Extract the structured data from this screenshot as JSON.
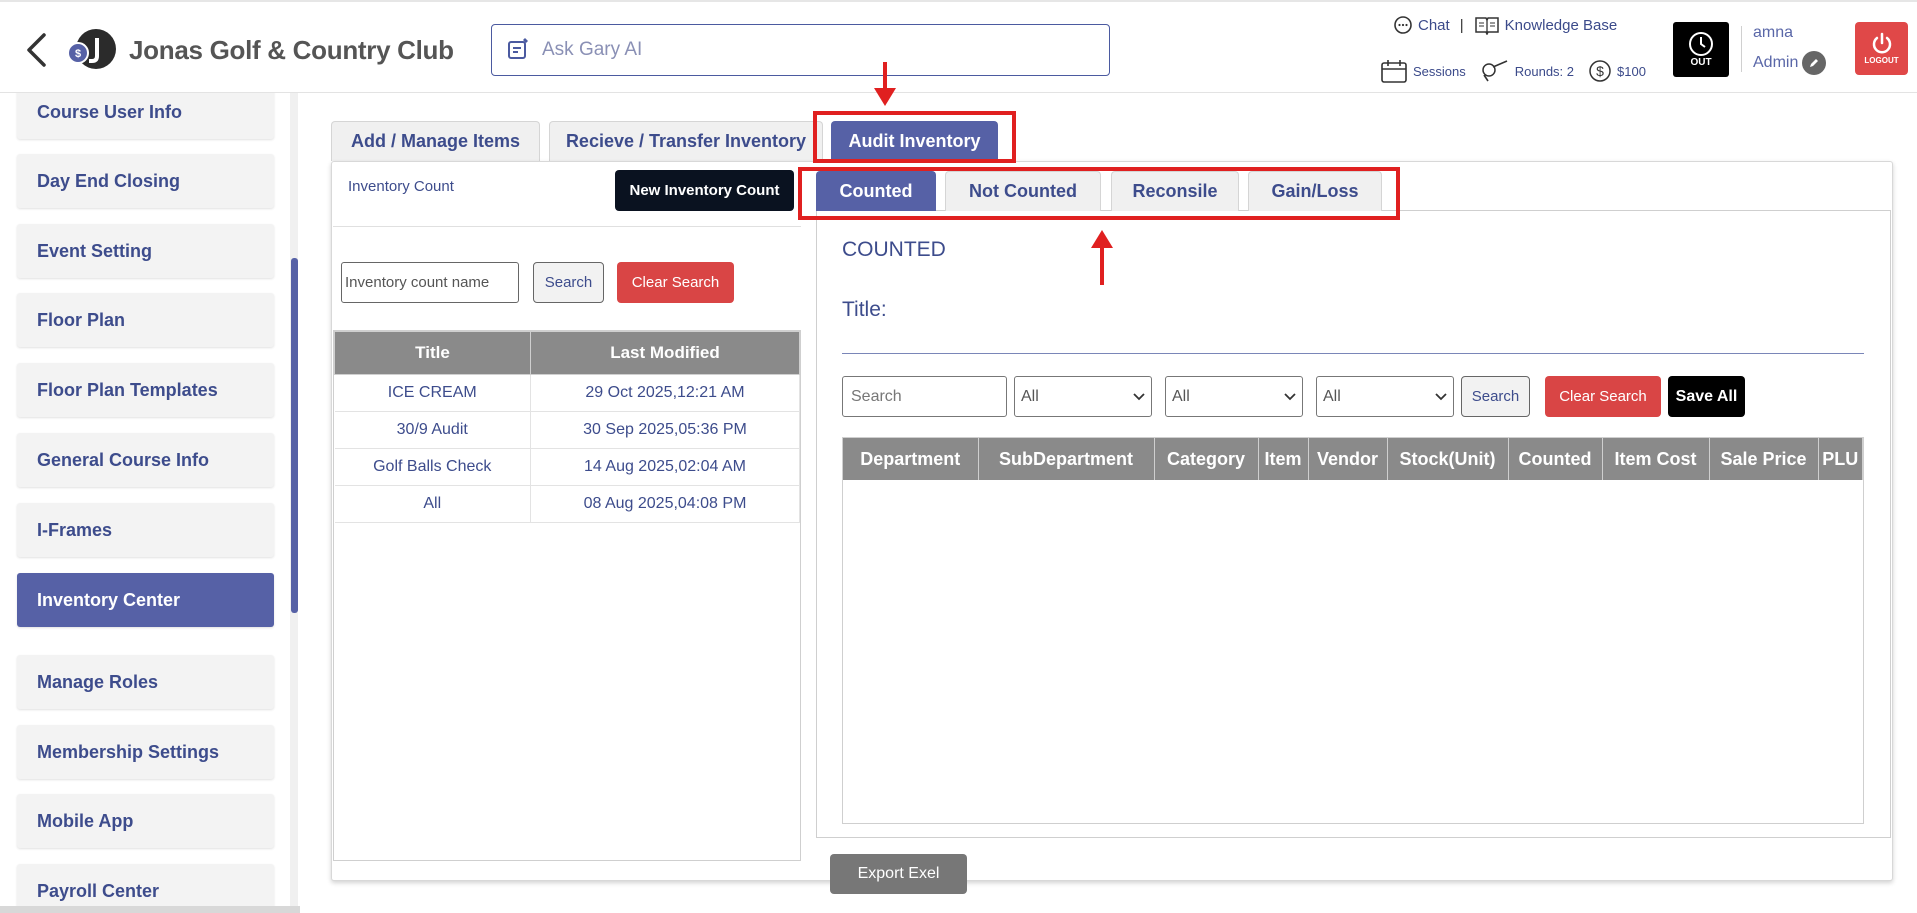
{
  "header": {
    "club_name": "Jonas Golf & Country Club",
    "logo_badge": "$",
    "ask_placeholder": "Ask Gary AI",
    "chat_label": "Chat",
    "separator": "|",
    "knowledge_base_label": "Knowledge Base",
    "sessions_label": "Sessions",
    "rounds_label": "Rounds: 2",
    "balance_label": "$100",
    "clock_label": "OUT",
    "user_name": "amna",
    "user_role": "Admin",
    "logout_label": "LOGOUT"
  },
  "sidebar": {
    "items": [
      {
        "label": "Course User Info"
      },
      {
        "label": "Day End Closing"
      },
      {
        "label": "Event Setting"
      },
      {
        "label": "Floor Plan"
      },
      {
        "label": "Floor Plan Templates"
      },
      {
        "label": "General Course Info"
      },
      {
        "label": "I-Frames"
      },
      {
        "label": "Inventory Center"
      },
      {
        "label": "Manage Roles"
      },
      {
        "label": "Membership Settings"
      },
      {
        "label": "Mobile App"
      },
      {
        "label": "Payroll Center"
      }
    ],
    "active_index": 7
  },
  "main_tabs": [
    {
      "label": "Add / Manage Items"
    },
    {
      "label": "Recieve / Transfer Inventory"
    },
    {
      "label": "Audit Inventory"
    }
  ],
  "left_panel": {
    "inventory_count_label": "Inventory Count",
    "new_button": "New Inventory Count",
    "search_placeholder": "Inventory count name",
    "search_button": "Search",
    "clear_button": "Clear Search",
    "columns": [
      "Title",
      "Last Modified"
    ],
    "rows": [
      {
        "title": "ICE CREAM",
        "modified": "29 Oct 2025,12:21 AM"
      },
      {
        "title": "30/9 Audit",
        "modified": "30 Sep 2025,05:36 PM"
      },
      {
        "title": "Golf Balls Check",
        "modified": "14 Aug 2025,02:04 AM"
      },
      {
        "title": "All",
        "modified": "08 Aug 2025,04:08 PM"
      }
    ]
  },
  "sub_tabs": [
    {
      "label": "Counted"
    },
    {
      "label": "Not Counted"
    },
    {
      "label": "Reconsile"
    },
    {
      "label": "Gain/Loss"
    }
  ],
  "counted_panel": {
    "heading": "COUNTED",
    "title_label": "Title:",
    "search_placeholder": "Search",
    "filters": [
      "All",
      "All",
      "All"
    ],
    "search_button": "Search",
    "clear_button": "Clear Search",
    "save_all_button": "Save All",
    "columns": [
      "Department",
      "SubDepartment",
      "Category",
      "Item",
      "Vendor",
      "Stock(Unit)",
      "Counted",
      "Item Cost",
      "Sale Price",
      "PLU"
    ]
  },
  "export_button": "Export Exel",
  "colors": {
    "accent": "#5661a6",
    "text": "#3d4c8c",
    "danger": "#d94545",
    "annotation": "#e02020"
  }
}
